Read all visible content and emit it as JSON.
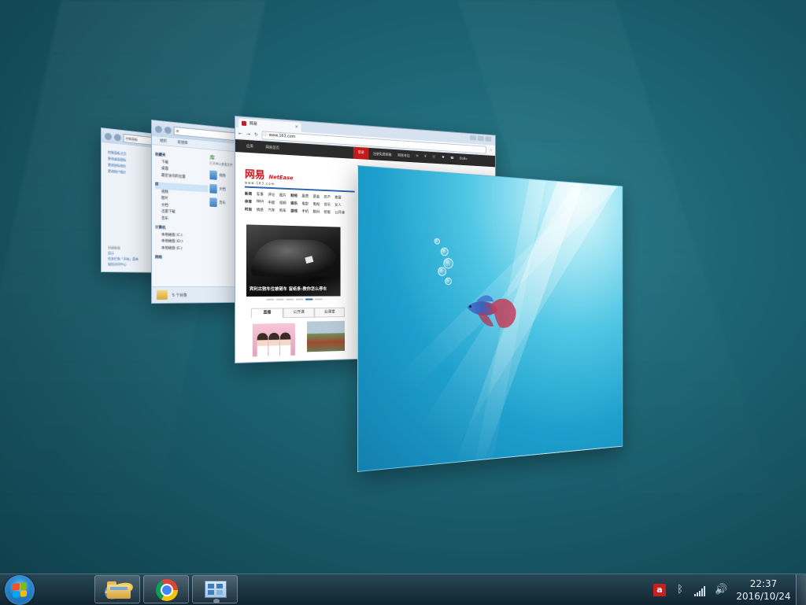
{
  "control_panel": {
    "address": "控制面板",
    "links": [
      "控制面板主页",
      "更改桌面图标",
      "更改鼠标指针",
      "更改帐户图片"
    ],
    "see_also_heading": "另请参阅",
    "see_also": [
      "显示",
      "任务栏和「开始」菜单",
      "轻松访问中心"
    ]
  },
  "explorer": {
    "address": "库",
    "toolbar": [
      "组织",
      "新建库"
    ],
    "nav": {
      "favorites": "收藏夹",
      "favorites_items": [
        "下载",
        "桌面",
        "最近访问的位置"
      ],
      "libraries": "库",
      "libraries_items": [
        "视频",
        "图片",
        "文档",
        "迅雷下载",
        "音乐"
      ],
      "computer": "计算机",
      "computer_items": [
        "本地磁盘 (C:)",
        "本地磁盘 (D:)",
        "本地磁盘 (E:)"
      ],
      "network": "网络"
    },
    "pane_title": "库",
    "pane_subtitle": "打开库以查看文件",
    "items": [
      "视频",
      "文档",
      "音乐"
    ],
    "status": "5 个对象"
  },
  "browser": {
    "tab_title": "网易",
    "url": "www.163.com",
    "nav_left": [
      "应用",
      "网易首页"
    ],
    "login": "登录",
    "nav_right": [
      "注册免费邮箱",
      "网易考拉",
      "BoBo"
    ],
    "logo_cn": "网易",
    "logo_en": "NetEase",
    "logo_domain": "www.163.com",
    "categories": [
      "新闻",
      "军事",
      "评论",
      "图片",
      "财经",
      "股票",
      "基金",
      "房产",
      "家居",
      "体育",
      "NBA",
      "中超",
      "视频",
      "娱乐",
      "电影",
      "电视",
      "音乐",
      "女人",
      "时尚",
      "情感",
      "汽车",
      "购车",
      "游戏",
      "手机",
      "数码",
      "智能",
      "公开课"
    ],
    "hero_caption": "宾利古驰车位被砸车 留纸条:教你怎么停车",
    "subtabs": [
      "直播",
      "公开课",
      "云课堂"
    ]
  },
  "taskbar": {
    "time": "22:37",
    "date": "2016/10/24",
    "pinned": [
      "internet-explorer",
      "windows-explorer",
      "google-chrome",
      "remote-desktop"
    ]
  },
  "colors": {
    "accent_red": "#c4161c",
    "taskbar": "#10303e",
    "wallpaper": "#1d6676"
  }
}
